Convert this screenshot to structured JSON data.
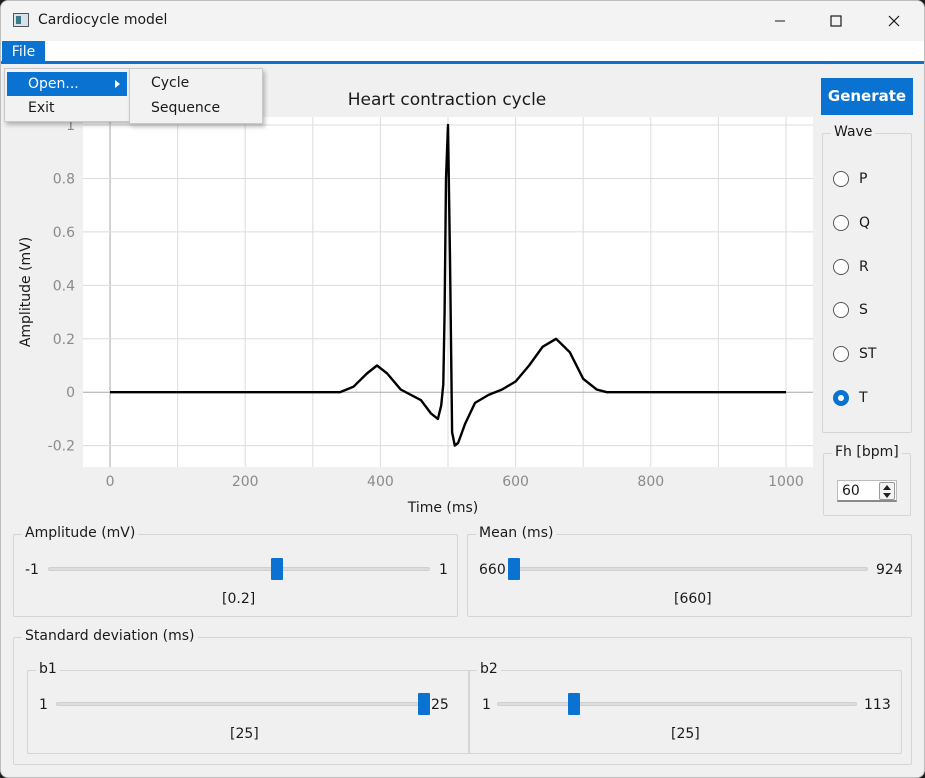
{
  "window": {
    "title": "Cardiocycle model",
    "accent_color": "#0a73d1"
  },
  "menu": {
    "file_label": "File",
    "items": [
      {
        "label": "Open...",
        "has_submenu": true
      },
      {
        "label": "Exit"
      }
    ],
    "open_submenu": [
      {
        "label": "Cycle"
      },
      {
        "label": "Sequence"
      }
    ]
  },
  "generate_label": "Generate",
  "wave": {
    "label": "Wave",
    "options": [
      {
        "label": "P",
        "selected": false
      },
      {
        "label": "Q",
        "selected": false
      },
      {
        "label": "R",
        "selected": false
      },
      {
        "label": "S",
        "selected": false
      },
      {
        "label": "ST",
        "selected": false
      },
      {
        "label": "T",
        "selected": true
      }
    ]
  },
  "fh": {
    "label": "Fh [bpm]",
    "value": "60"
  },
  "amplitude": {
    "label": "Amplitude (mV)",
    "min": "-1",
    "max": "1",
    "value": 0.2,
    "value_text": "[0.2]"
  },
  "mean": {
    "label": "Mean (ms)",
    "min": "660",
    "max": "924",
    "value": 660,
    "value_text": "[660]"
  },
  "std": {
    "label": "Standard deviation (ms)",
    "b1": {
      "label": "b1",
      "min": "1",
      "max": "25",
      "value": 25,
      "value_text": "[25]"
    },
    "b2": {
      "label": "b2",
      "min": "1",
      "max": "113",
      "value": 25,
      "value_text": "[25]"
    }
  },
  "chart_data": {
    "type": "line",
    "title": "Heart contraction cycle",
    "xlabel": "Time (ms)",
    "ylabel": "Amplitude (mV)",
    "xlim": [
      -40,
      1040
    ],
    "ylim": [
      -0.28,
      1.03
    ],
    "x_ticks": [
      "0",
      "200",
      "400",
      "600",
      "800",
      "1000"
    ],
    "y_ticks": [
      "1",
      "0.8",
      "0.6",
      "0.4",
      "0.2",
      "0",
      "-0.2"
    ],
    "grid": true,
    "series": [
      {
        "color": "#000000",
        "x": [
          0,
          340,
          360,
          380,
          395,
          410,
          430,
          460,
          475,
          485,
          490,
          493,
          495,
          497,
          500,
          503,
          506,
          510,
          515,
          525,
          540,
          560,
          580,
          600,
          620,
          640,
          660,
          680,
          700,
          720,
          735,
          760,
          1000
        ],
        "y": [
          0,
          0,
          0.02,
          0.07,
          0.1,
          0.07,
          0.01,
          -0.03,
          -0.08,
          -0.1,
          -0.05,
          0.03,
          0.3,
          0.8,
          1.0,
          0.5,
          -0.15,
          -0.2,
          -0.19,
          -0.12,
          -0.04,
          -0.01,
          0.01,
          0.04,
          0.1,
          0.17,
          0.2,
          0.15,
          0.05,
          0.01,
          0,
          0,
          0
        ]
      }
    ]
  }
}
